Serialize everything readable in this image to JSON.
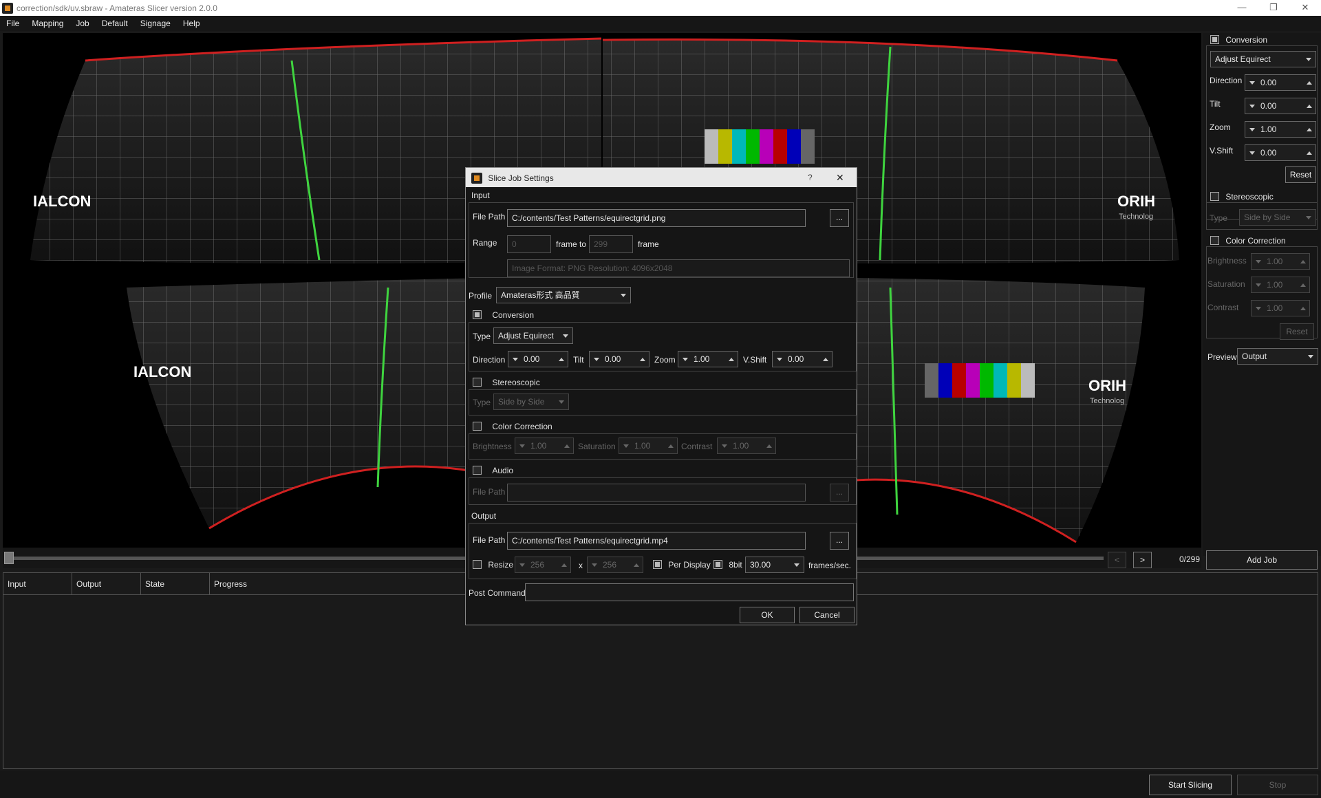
{
  "window": {
    "title": "correction/sdk/uv.sbraw - Amateras Slicer version 2.0.0",
    "minimize": "—",
    "maximize": "❐",
    "close": "✕"
  },
  "menu": [
    "File",
    "Mapping",
    "Job",
    "Default",
    "Signage",
    "Help"
  ],
  "viewer": {
    "left_banner": "IALCON",
    "right_banner": "ORIH",
    "right_sub": "Technolog",
    "colors": {
      "grid": "#9a9a9a",
      "center_line": "#3fd43f",
      "edge": "#d02020"
    }
  },
  "side": {
    "conversion_label": "Conversion",
    "conversion_checked": true,
    "type_value": "Adjust Equirect",
    "direction_label": "Direction",
    "direction_value": "0.00",
    "tilt_label": "Tilt",
    "tilt_value": "0.00",
    "zoom_label": "Zoom",
    "zoom_value": "1.00",
    "vshift_label": "V.Shift",
    "vshift_value": "0.00",
    "reset_label": "Reset",
    "stereo_label": "Stereoscopic",
    "stereo_type_label": "Type",
    "stereo_type_value": "Side by Side",
    "cc_label": "Color Correction",
    "brightness_label": "Brightness",
    "brightness_value": "1.00",
    "saturation_label": "Saturation",
    "saturation_value": "1.00",
    "contrast_label": "Contrast",
    "contrast_value": "1.00",
    "cc_reset_label": "Reset",
    "preview_label": "Preview",
    "preview_value": "Output"
  },
  "timeline": {
    "prev": "<",
    "next": ">",
    "counter": "0/299",
    "add_job": "Add Job"
  },
  "table": {
    "columns": [
      "Input",
      "Output",
      "State",
      "Progress"
    ]
  },
  "bottom": {
    "start": "Start Slicing",
    "stop": "Stop"
  },
  "dialog": {
    "title": "Slice Job Settings",
    "help": "?",
    "close": "✕",
    "input_section": "Input",
    "file_path_label": "File Path",
    "file_path_value": "C:/contents/Test Patterns/equirectgrid.png",
    "browse": "...",
    "range_label": "Range",
    "range_from": "0",
    "frame_to_label": "frame to",
    "range_to": "299",
    "frame_label": "frame",
    "image_info": "Image Format: PNG Resolution: 4096x2048",
    "profile_label": "Profile",
    "profile_value": "Amateras形式 高品質",
    "conversion_label": "Conversion",
    "type_label": "Type",
    "type_value": "Adjust Equirect",
    "direction_label": "Direction",
    "direction_value": "0.00",
    "tilt_label": "Tilt",
    "tilt_value": "0.00",
    "zoom_label": "Zoom",
    "zoom_value": "1.00",
    "vshift_label": "V.Shift",
    "vshift_value": "0.00",
    "stereo_label": "Stereoscopic",
    "stereo_type_label": "Type",
    "stereo_type_value": "Side by Side",
    "cc_label": "Color Correction",
    "brightness_label": "Brightness",
    "brightness_value": "1.00",
    "saturation_label": "Saturation",
    "saturation_value": "1.00",
    "contrast_label": "Contrast",
    "contrast_value": "1.00",
    "audio_label": "Audio",
    "audio_path_label": "File Path",
    "audio_path_value": "",
    "audio_browse": "...",
    "output_section": "Output",
    "out_path_label": "File Path",
    "out_path_value": "C:/contents/Test Patterns/equirectgrid.mp4",
    "out_browse": "...",
    "resize_label": "Resize",
    "resize_w": "256",
    "x_label": "x",
    "resize_h": "256",
    "per_display_label": "Per Display",
    "bit8_label": "8bit",
    "fps_value": "30.00",
    "fps_label": "frames/sec.",
    "post_command_label": "Post Command",
    "post_command_value": "",
    "ok": "OK",
    "cancel": "Cancel"
  }
}
